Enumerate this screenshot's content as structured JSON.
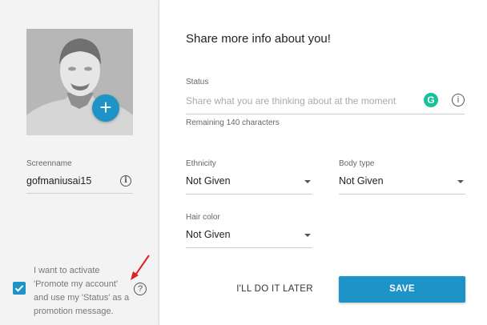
{
  "left": {
    "screenname_label": "Screenname",
    "screenname_value": "gofmaniusai15",
    "add_photo_symbol": "+",
    "promo_text": "I want to activate 'Promote my account' and use my 'Status' as a promotion message.",
    "promo_checked": true,
    "help_symbol": "?"
  },
  "right": {
    "title": "Share more info about you!",
    "status": {
      "label": "Status",
      "placeholder": "Share what you are thinking about at the moment",
      "remaining": "Remaining 140 characters",
      "grammarly_letter": "G"
    },
    "ethnicity": {
      "label": "Ethnicity",
      "value": "Not Given"
    },
    "body_type": {
      "label": "Body type",
      "value": "Not Given"
    },
    "hair_color": {
      "label": "Hair color",
      "value": "Not Given"
    },
    "later_label": "I'LL DO IT LATER",
    "save_label": "SAVE"
  },
  "colors": {
    "accent": "#1e93c8",
    "grammarly": "#15c39a",
    "annotation_arrow": "#e02020"
  },
  "icons": [
    "add-photo-icon",
    "info-icon",
    "grammarly-icon",
    "help-icon",
    "checkmark-icon",
    "caret-down-icon"
  ]
}
